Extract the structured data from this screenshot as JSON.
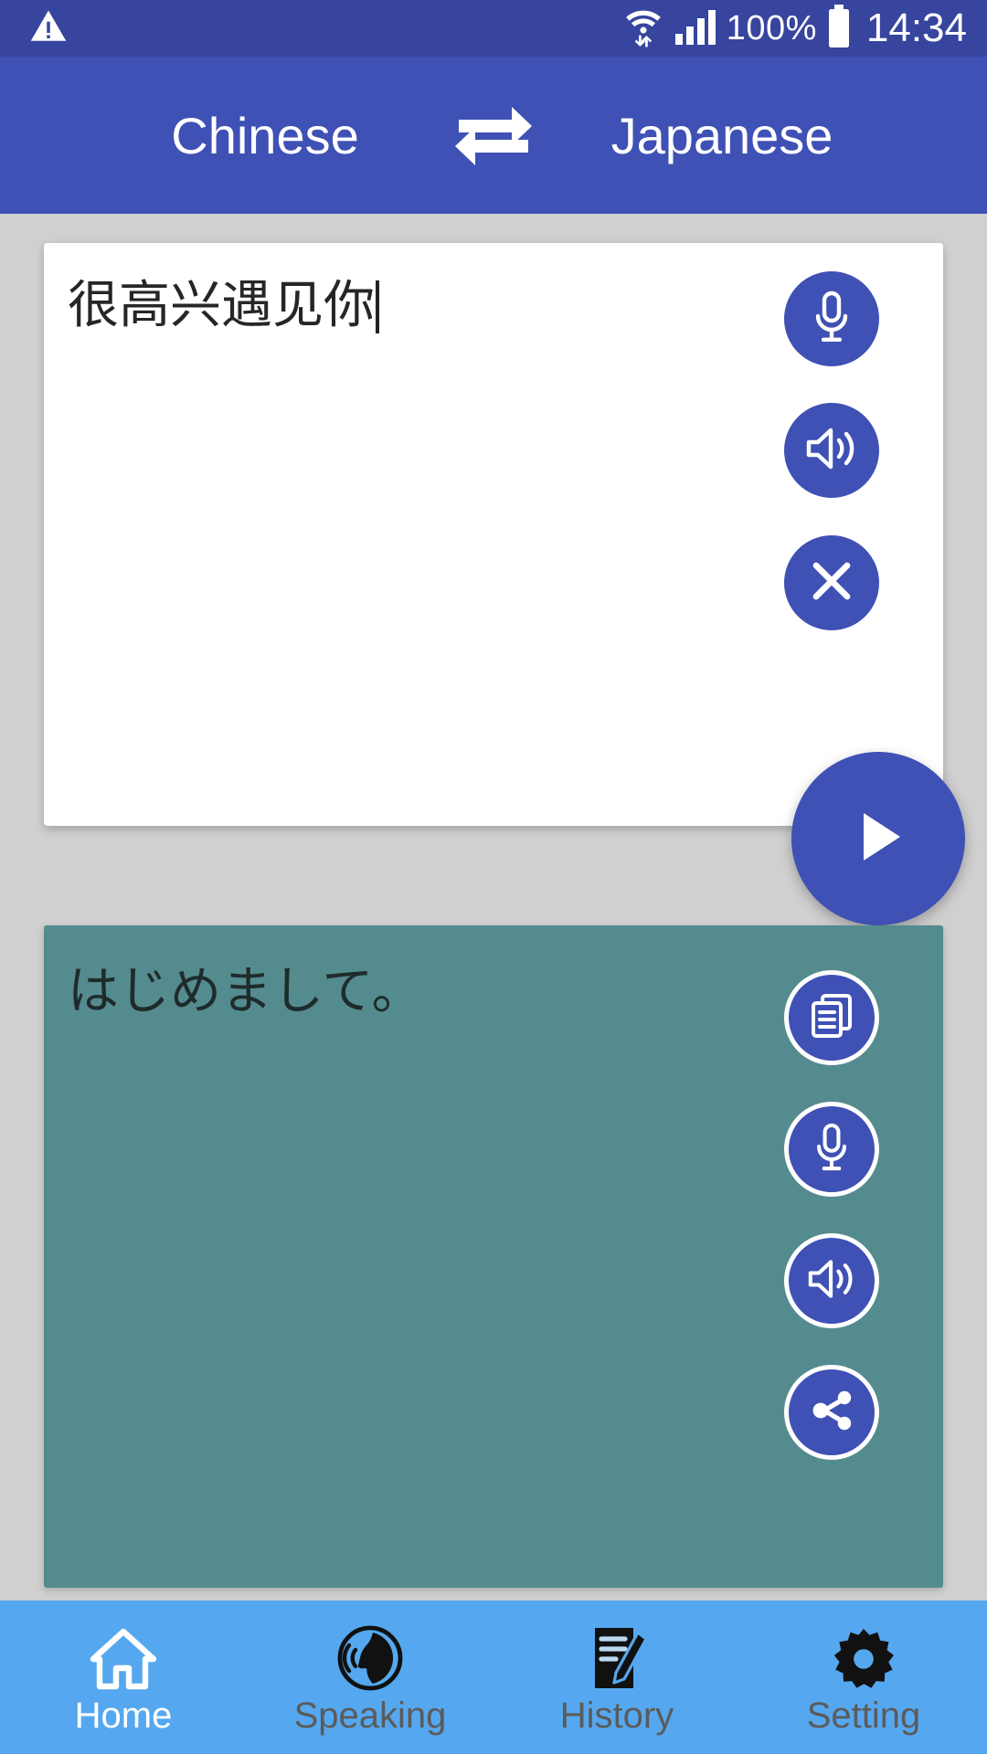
{
  "status_bar": {
    "warning_icon": "warning-triangle-icon",
    "wifi_icon": "wifi-icon",
    "signal_icon": "cellular-signal-icon",
    "battery_percent": "100%",
    "battery_icon": "battery-full-icon",
    "clock": "14:34"
  },
  "header": {
    "source_language": "Chinese",
    "target_language": "Japanese",
    "swap_icon": "swap-arrows-icon"
  },
  "input": {
    "text": "很高兴遇见你",
    "buttons": [
      {
        "name": "mic",
        "icon": "microphone-icon"
      },
      {
        "name": "speak",
        "icon": "speaker-icon"
      },
      {
        "name": "clear",
        "icon": "close-x-icon"
      }
    ],
    "translate_icon": "play-triangle-icon"
  },
  "output": {
    "text": "はじめまして。",
    "buttons": [
      {
        "name": "copy",
        "icon": "copy-documents-icon"
      },
      {
        "name": "mic",
        "icon": "microphone-icon"
      },
      {
        "name": "speak",
        "icon": "speaker-icon"
      },
      {
        "name": "share",
        "icon": "share-nodes-icon"
      }
    ]
  },
  "bottom_nav": {
    "items": [
      {
        "label": "Home",
        "icon": "home-icon",
        "active": true
      },
      {
        "label": "Speaking",
        "icon": "speaking-head-icon",
        "active": false
      },
      {
        "label": "History",
        "icon": "note-pencil-icon",
        "active": false
      },
      {
        "label": "Setting",
        "icon": "gear-icon",
        "active": false
      }
    ]
  },
  "colors": {
    "status_bar": "#37459e",
    "header": "#3f51b5",
    "accent": "#3f51b5",
    "page_background": "#d0d0d0",
    "output_panel": "#548b8e",
    "bottom_nav": "#55a8ef",
    "nav_active": "#ffffff",
    "nav_inactive": "#5b5b5b"
  }
}
